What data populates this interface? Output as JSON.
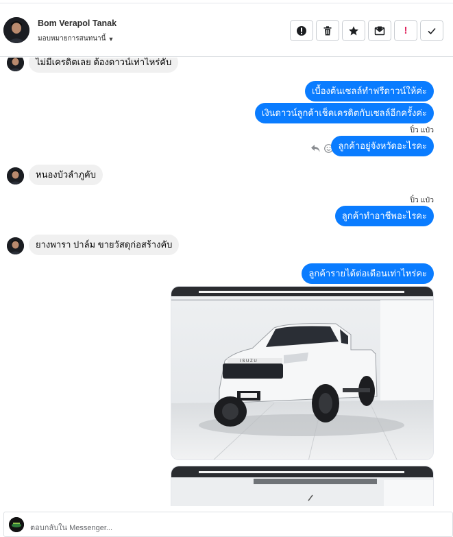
{
  "contact": {
    "name": "Bom Verapol Tanak",
    "assign_label": "มอบหมายการสนทนานี้"
  },
  "toolbar": {
    "buttons": [
      {
        "name": "mark-as-spam",
        "icon": "alert-circle-icon"
      },
      {
        "name": "delete",
        "icon": "trash-icon"
      },
      {
        "name": "star",
        "icon": "star-icon"
      },
      {
        "name": "mark-unread",
        "icon": "mail-icon"
      },
      {
        "name": "follow-up",
        "icon": "exclamation-icon",
        "label": "!"
      },
      {
        "name": "mark-done",
        "icon": "check-icon"
      }
    ]
  },
  "messages": [
    {
      "dir": "in",
      "text": "ไม่มีเครดิตเลย ต้องดาวน์เท่าไหร่คับ"
    },
    {
      "dir": "out",
      "text": "เบื้องต้นเซลล์ทำฟรีดาวน์ให้ค่ะ"
    },
    {
      "dir": "out",
      "text": "เงินดาวน์ลูกค้าเช็คเครดิตกับเซลล์อีกครั้งค่ะ"
    },
    {
      "dir": "sender",
      "text": "ปิ๋ว แป๋ว"
    },
    {
      "dir": "out",
      "text": "ลูกค้าอยู่จังหวัดอะไรคะ"
    },
    {
      "dir": "in",
      "text": "หนองบัวลำภูคับ"
    },
    {
      "dir": "sender",
      "text": "ปิ๋ว แป๋ว"
    },
    {
      "dir": "out",
      "text": "ลูกค้าทำอาชีพอะไรคะ"
    },
    {
      "dir": "in",
      "text": "ยางพารา ปาล์ม ขายวัสดุก่อสร้างคับ"
    },
    {
      "dir": "out",
      "text": "ลูกค้ารายได้ต่อเดือนเท่าไหร่คะ"
    }
  ],
  "composer": {
    "placeholder": "ตอบกลับใน Messenger..."
  },
  "colors": {
    "outgoing_bubble": "#0a7cff",
    "incoming_bubble": "#f0f0f0",
    "follow_up_icon": "#e0245e"
  }
}
